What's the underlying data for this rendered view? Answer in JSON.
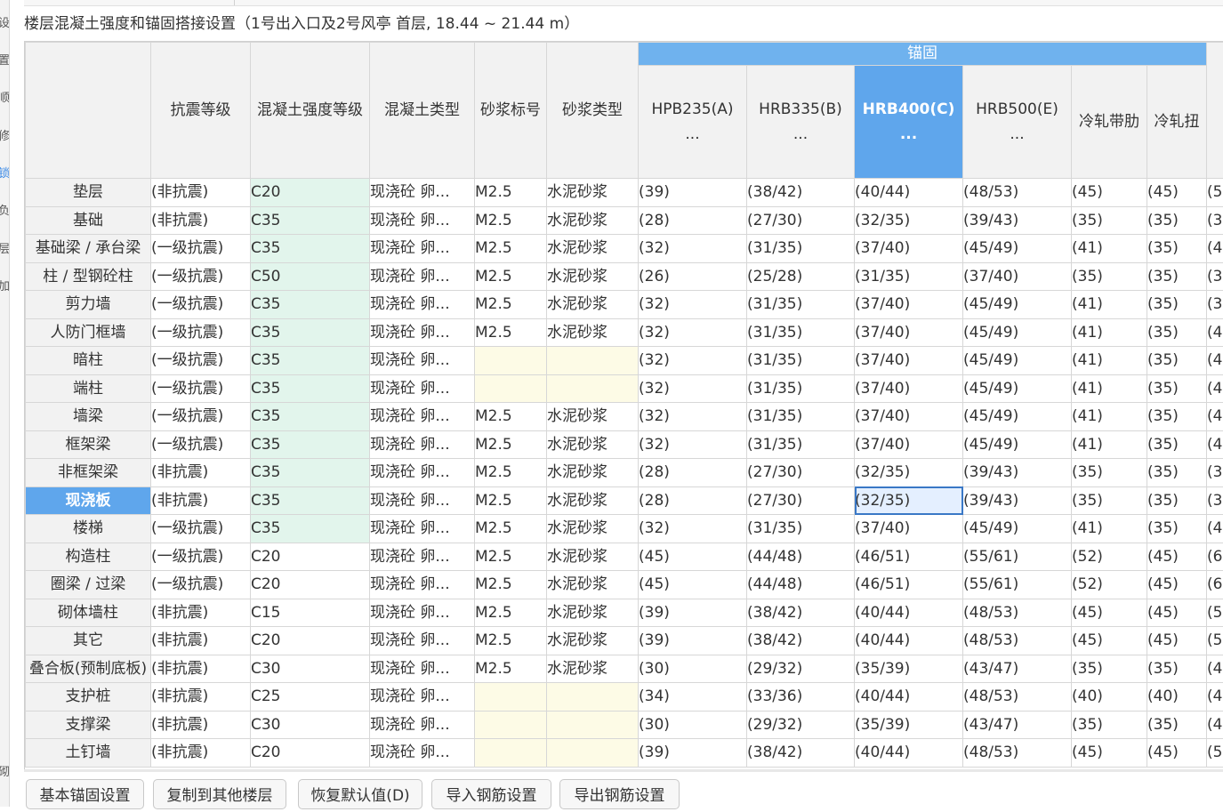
{
  "title": "楼层混凝土强度和锚固搭接设置（1号出入口及2号风亭  首层, 18.44 ~ 21.44 m）",
  "left_tabs": [
    "设",
    "置",
    "顺",
    "修",
    "锁",
    "负",
    "层",
    "加",
    "砌"
  ],
  "header": {
    "anchor_group": "锚固",
    "columns": [
      "抗震等级",
      "混凝土强度等级",
      "混凝土类型",
      "砂浆标号",
      "砂浆类型"
    ],
    "anchor_columns": [
      {
        "label": "HPB235(A)",
        "sub": "..."
      },
      {
        "label": "HRB335(B)",
        "sub": "..."
      },
      {
        "label": "HRB400(C)",
        "sub": "..."
      },
      {
        "label": "HRB500(E)",
        "sub": "..."
      },
      {
        "label": "冷轧带肋",
        "sub": ""
      },
      {
        "label": "冷轧扭",
        "sub": ""
      },
      {
        "label": "",
        "sub": ""
      }
    ]
  },
  "rows": [
    {
      "name": "垫层",
      "cells": [
        "(非抗震)",
        "C20",
        "现浇砼 卵...",
        "M2.5",
        "水泥砂浆",
        "(39)",
        "(38/42)",
        "(40/44)",
        "(48/53)",
        "(45)",
        "(45)",
        "(5"
      ]
    },
    {
      "name": "基础",
      "cells": [
        "(非抗震)",
        "C35",
        "现浇砼 卵...",
        "M2.5",
        "水泥砂浆",
        "(28)",
        "(27/30)",
        "(32/35)",
        "(39/43)",
        "(35)",
        "(35)",
        "(3"
      ]
    },
    {
      "name": "基础梁 / 承台梁",
      "cells": [
        "(一级抗震)",
        "C35",
        "现浇砼 卵...",
        "M2.5",
        "水泥砂浆",
        "(32)",
        "(31/35)",
        "(37/40)",
        "(45/49)",
        "(41)",
        "(35)",
        "(4"
      ]
    },
    {
      "name": "柱 / 型钢砼柱",
      "cells": [
        "(一级抗震)",
        "C50",
        "现浇砼 卵...",
        "M2.5",
        "水泥砂浆",
        "(26)",
        "(25/28)",
        "(31/35)",
        "(37/40)",
        "(35)",
        "(35)",
        "(3"
      ]
    },
    {
      "name": "剪力墙",
      "cells": [
        "(一级抗震)",
        "C35",
        "现浇砼 卵...",
        "M2.5",
        "水泥砂浆",
        "(32)",
        "(31/35)",
        "(37/40)",
        "(45/49)",
        "(41)",
        "(35)",
        "(3"
      ]
    },
    {
      "name": "人防门框墙",
      "cells": [
        "(一级抗震)",
        "C35",
        "现浇砼 卵...",
        "M2.5",
        "水泥砂浆",
        "(32)",
        "(31/35)",
        "(37/40)",
        "(45/49)",
        "(41)",
        "(35)",
        "(4"
      ]
    },
    {
      "name": "暗柱",
      "cells": [
        "(一级抗震)",
        "C35",
        "现浇砼 卵...",
        "",
        "",
        "(32)",
        "(31/35)",
        "(37/40)",
        "(45/49)",
        "(41)",
        "(35)",
        "(4"
      ]
    },
    {
      "name": "端柱",
      "cells": [
        "(一级抗震)",
        "C35",
        "现浇砼 卵...",
        "",
        "",
        "(32)",
        "(31/35)",
        "(37/40)",
        "(45/49)",
        "(41)",
        "(35)",
        "(4"
      ]
    },
    {
      "name": "墙梁",
      "cells": [
        "(一级抗震)",
        "C35",
        "现浇砼 卵...",
        "M2.5",
        "水泥砂浆",
        "(32)",
        "(31/35)",
        "(37/40)",
        "(45/49)",
        "(41)",
        "(35)",
        "(4"
      ]
    },
    {
      "name": "框架梁",
      "cells": [
        "(一级抗震)",
        "C35",
        "现浇砼 卵...",
        "M2.5",
        "水泥砂浆",
        "(32)",
        "(31/35)",
        "(37/40)",
        "(45/49)",
        "(41)",
        "(35)",
        "(4"
      ]
    },
    {
      "name": "非框架梁",
      "cells": [
        "(非抗震)",
        "C35",
        "现浇砼 卵...",
        "M2.5",
        "水泥砂浆",
        "(28)",
        "(27/30)",
        "(32/35)",
        "(39/43)",
        "(35)",
        "(35)",
        "(3"
      ]
    },
    {
      "name": "现浇板",
      "cells": [
        "(非抗震)",
        "C35",
        "现浇砼 卵...",
        "M2.5",
        "水泥砂浆",
        "(28)",
        "(27/30)",
        "(32/35)",
        "(39/43)",
        "(35)",
        "(35)",
        "(3"
      ]
    },
    {
      "name": "楼梯",
      "cells": [
        "(一级抗震)",
        "C35",
        "现浇砼 卵...",
        "M2.5",
        "水泥砂浆",
        "(32)",
        "(31/35)",
        "(37/40)",
        "(45/49)",
        "(41)",
        "(35)",
        "(4"
      ]
    },
    {
      "name": "构造柱",
      "cells": [
        "(一级抗震)",
        "C20",
        "现浇砼 卵...",
        "M2.5",
        "水泥砂浆",
        "(45)",
        "(44/48)",
        "(46/51)",
        "(55/61)",
        "(52)",
        "(45)",
        "(6"
      ]
    },
    {
      "name": "圈梁 / 过梁",
      "cells": [
        "(一级抗震)",
        "C20",
        "现浇砼 卵...",
        "M2.5",
        "水泥砂浆",
        "(45)",
        "(44/48)",
        "(46/51)",
        "(55/61)",
        "(52)",
        "(45)",
        "(6"
      ]
    },
    {
      "name": "砌体墙柱",
      "cells": [
        "(非抗震)",
        "C15",
        "现浇砼 卵...",
        "M2.5",
        "水泥砂浆",
        "(39)",
        "(38/42)",
        "(40/44)",
        "(48/53)",
        "(45)",
        "(45)",
        "(5"
      ]
    },
    {
      "name": "其它",
      "cells": [
        "(非抗震)",
        "C20",
        "现浇砼 卵...",
        "M2.5",
        "水泥砂浆",
        "(39)",
        "(38/42)",
        "(40/44)",
        "(48/53)",
        "(45)",
        "(45)",
        "(5"
      ]
    },
    {
      "name": "叠合板(预制底板)",
      "cells": [
        "(非抗震)",
        "C30",
        "现浇砼 卵...",
        "M2.5",
        "水泥砂浆",
        "(30)",
        "(29/32)",
        "(35/39)",
        "(43/47)",
        "(35)",
        "(35)",
        "(4"
      ]
    },
    {
      "name": "支护桩",
      "cells": [
        "(非抗震)",
        "C25",
        "现浇砼 卵...",
        "",
        "",
        "(34)",
        "(33/36)",
        "(40/44)",
        "(48/53)",
        "(40)",
        "(40)",
        "(4"
      ]
    },
    {
      "name": "支撑梁",
      "cells": [
        "(非抗震)",
        "C30",
        "现浇砼 卵...",
        "",
        "",
        "(30)",
        "(29/32)",
        "(35/39)",
        "(43/47)",
        "(35)",
        "(35)",
        "(4"
      ]
    },
    {
      "name": "土钉墙",
      "cells": [
        "(非抗震)",
        "C20",
        "现浇砼 卵...",
        "",
        "",
        "(39)",
        "(38/42)",
        "(40/44)",
        "(48/53)",
        "(45)",
        "(45)",
        "(5"
      ]
    }
  ],
  "green_rows_count": 13,
  "selected_row": "现浇板",
  "selected_col": "HRB400(C)",
  "buttons": [
    "基本锚固设置",
    "复制到其他楼层",
    "恢复默认值(D)",
    "导入钢筋设置",
    "导出钢筋设置"
  ]
}
